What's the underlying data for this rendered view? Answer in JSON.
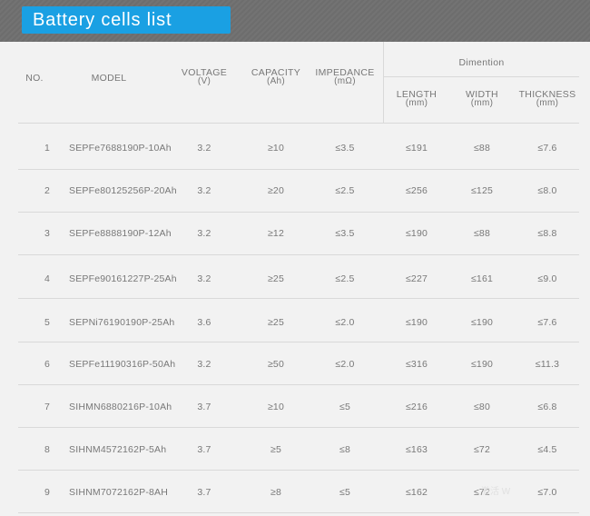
{
  "title": "Battery cells  list",
  "headers": {
    "no": "NO.",
    "model": "MODEL",
    "voltage": "VOLTAGE",
    "voltage_unit": "(V)",
    "capacity": "CAPACITY",
    "capacity_unit": "(Ah)",
    "impedance": "IMPEDANCE",
    "impedance_unit": "(mΩ)",
    "dimention": "Dimention",
    "length": "LENGTH",
    "length_unit": "(mm)",
    "width": "WIDTH",
    "width_unit": "(mm)",
    "thickness": "THICKNESS",
    "thickness_unit": "(mm)"
  },
  "rows": [
    {
      "no": "1",
      "model": "SEPFe7688190P-10Ah",
      "voltage": "3.2",
      "capacity": "≥10",
      "impedance": "≤3.5",
      "length": "≤191",
      "width": "≤88",
      "thickness": "≤7.6"
    },
    {
      "no": "2",
      "model": "SEPFe80125256P-20Ah",
      "voltage": "3.2",
      "capacity": "≥20",
      "impedance": "≤2.5",
      "length": "≤256",
      "width": "≤125",
      "thickness": "≤8.0"
    },
    {
      "no": "3",
      "model": "SEPFe8888190P-12Ah",
      "voltage": "3.2",
      "capacity": "≥12",
      "impedance": "≤3.5",
      "length": "≤190",
      "width": "≤88",
      "thickness": "≤8.8"
    },
    {
      "no": "4",
      "model": "SEPFe90161227P-25Ah",
      "voltage": "3.2",
      "capacity": "≥25",
      "impedance": "≤2.5",
      "length": "≤227",
      "width": "≤161",
      "thickness": "≤9.0"
    },
    {
      "no": "5",
      "model": "SEPNi76190190P-25Ah",
      "voltage": "3.6",
      "capacity": "≥25",
      "impedance": "≤2.0",
      "length": "≤190",
      "width": "≤190",
      "thickness": "≤7.6"
    },
    {
      "no": "6",
      "model": "SEPFe11190316P-50Ah",
      "voltage": "3.2",
      "capacity": "≥50",
      "impedance": "≤2.0",
      "length": "≤316",
      "width": "≤190",
      "thickness": "≤11.3"
    },
    {
      "no": "7",
      "model": "SIHMN6880216P-10Ah",
      "voltage": "3.7",
      "capacity": "≥10",
      "impedance": "≤5",
      "length": "≤216",
      "width": "≤80",
      "thickness": "≤6.8"
    },
    {
      "no": "8",
      "model": "SIHNM4572162P-5Ah",
      "voltage": "3.7",
      "capacity": "≥5",
      "impedance": "≤8",
      "length": "≤163",
      "width": "≤72",
      "thickness": "≤4.5"
    },
    {
      "no": "9",
      "model": "SIHNM7072162P-8AH",
      "voltage": "3.7",
      "capacity": "≥8",
      "impedance": "≤5",
      "length": "≤162",
      "width": "≤72",
      "thickness": "≤7.0"
    }
  ],
  "watermark": "激活 W"
}
